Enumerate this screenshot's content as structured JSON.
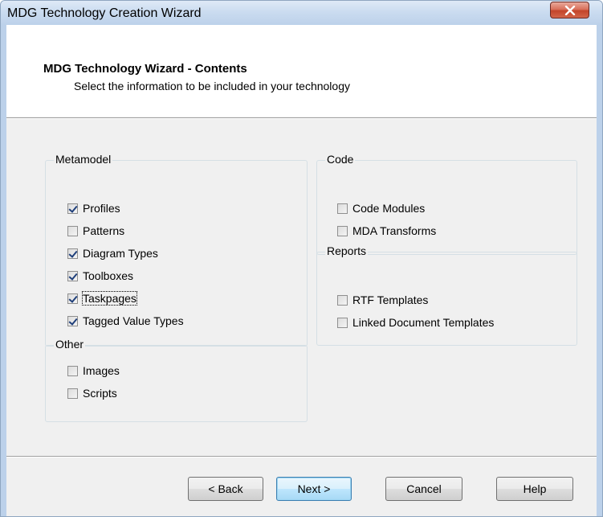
{
  "window": {
    "title": "MDG Technology Creation Wizard"
  },
  "header": {
    "title": "MDG Technology Wizard - Contents",
    "subtitle": "Select the information to be included in your technology"
  },
  "groups": {
    "metamodel": {
      "label": "Metamodel",
      "items": [
        {
          "label": "Profiles",
          "checked": true
        },
        {
          "label": "Patterns",
          "checked": false
        },
        {
          "label": "Diagram Types",
          "checked": true
        },
        {
          "label": "Toolboxes",
          "checked": true
        },
        {
          "label": "Taskpages",
          "checked": true,
          "focused": true
        },
        {
          "label": "Tagged Value Types",
          "checked": true
        }
      ]
    },
    "code": {
      "label": "Code",
      "items": [
        {
          "label": "Code Modules",
          "checked": false
        },
        {
          "label": "MDA Transforms",
          "checked": false
        }
      ]
    },
    "reports": {
      "label": "Reports",
      "items": [
        {
          "label": "RTF Templates",
          "checked": false
        },
        {
          "label": "Linked Document Templates",
          "checked": false
        }
      ]
    },
    "other": {
      "label": "Other",
      "items": [
        {
          "label": "Images",
          "checked": false
        },
        {
          "label": "Scripts",
          "checked": false
        }
      ]
    }
  },
  "buttons": {
    "back": "< Back",
    "next": "Next >",
    "cancel": "Cancel",
    "help": "Help"
  },
  "icons": {
    "close": "close-icon"
  }
}
